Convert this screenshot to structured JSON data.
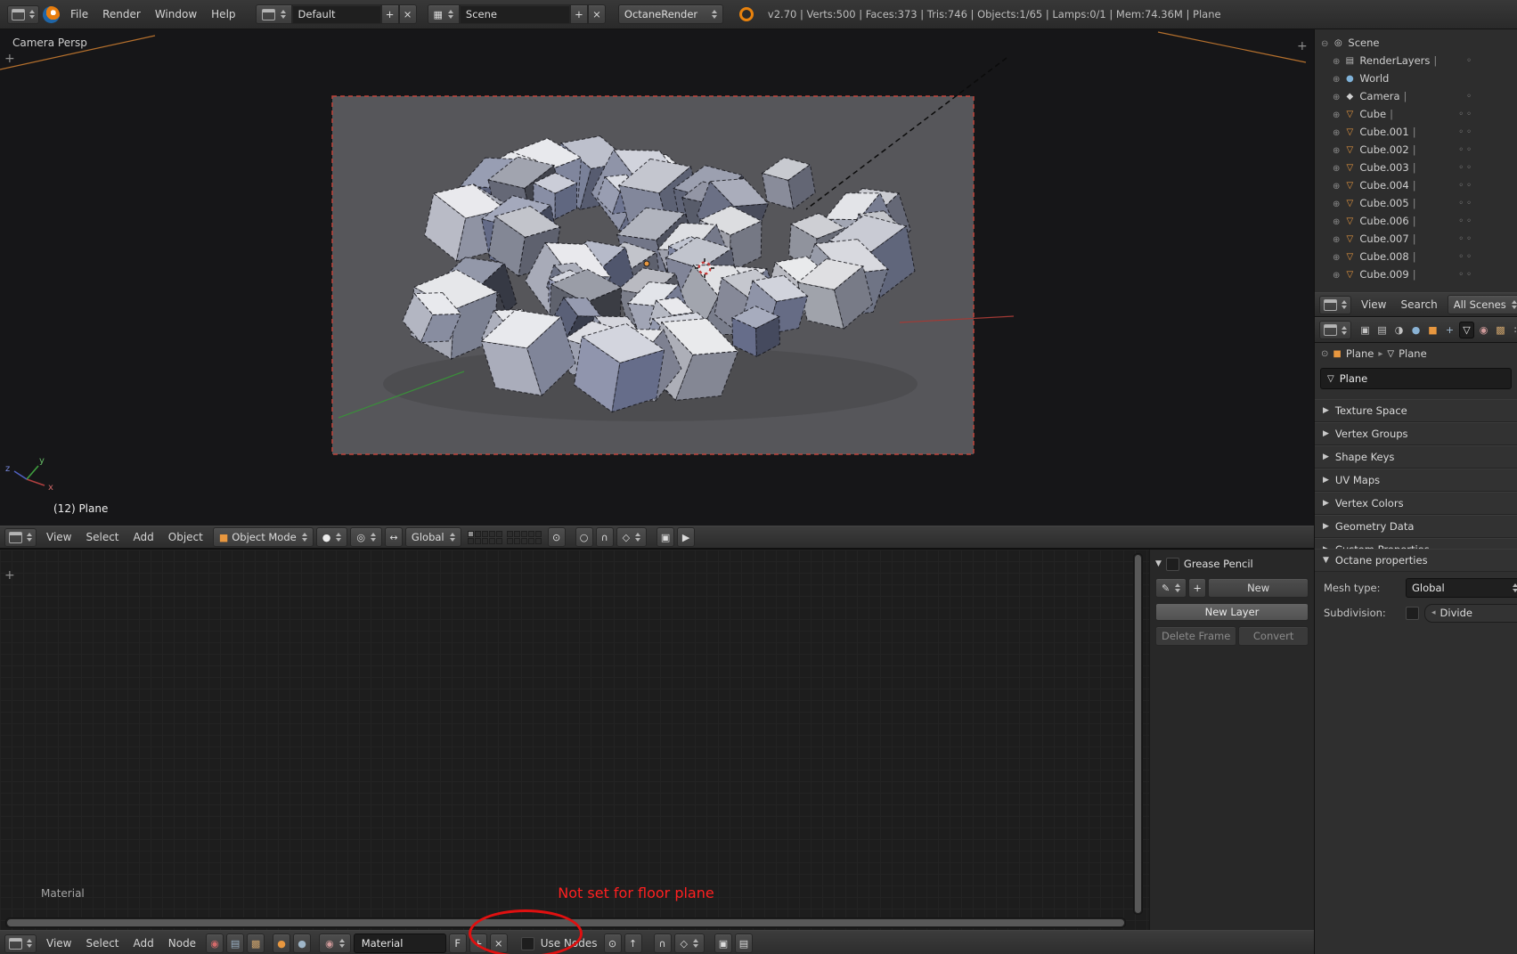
{
  "top_header": {
    "menus": [
      "File",
      "Render",
      "Window",
      "Help"
    ],
    "layout": {
      "value": "Default",
      "add": "+",
      "close": "×"
    },
    "scene": {
      "value": "Scene",
      "add": "+",
      "close": "×"
    },
    "engine": {
      "value": "OctaneRender"
    },
    "stats": "v2.70 | Verts:500 | Faces:373 | Tris:746 | Objects:1/65 | Lamps:0/1 | Mem:74.36M | Plane"
  },
  "viewport": {
    "view_label": "Camera Persp",
    "object_info": "(12) Plane",
    "axis": {
      "x": "x",
      "y": "y",
      "z": "z"
    },
    "header": {
      "menus": [
        "View",
        "Select",
        "Add",
        "Object"
      ],
      "mode": "Object Mode",
      "orientation": "Global"
    }
  },
  "node_editor": {
    "region_label": "Material",
    "annotation": "Not set for floor plane",
    "header": {
      "menus": [
        "View",
        "Select",
        "Add",
        "Node"
      ],
      "material_name": "Material",
      "fake_user": "F",
      "add": "+",
      "unlink": "×",
      "use_nodes_label": "Use Nodes"
    },
    "grease_pencil": {
      "title": "Grease Pencil",
      "add": "+",
      "new": "New",
      "new_layer": "New Layer",
      "delete_frame": "Delete Frame",
      "convert": "Convert"
    }
  },
  "outliner": {
    "items": [
      {
        "label": "Scene",
        "type": "scene",
        "indent": 0,
        "suffix": "",
        "expanded": true
      },
      {
        "label": "RenderLayers",
        "type": "renderlayers",
        "indent": 1,
        "suffix": "|"
      },
      {
        "label": "World",
        "type": "world",
        "indent": 1,
        "suffix": ""
      },
      {
        "label": "Camera",
        "type": "camera",
        "indent": 1,
        "suffix": "|"
      },
      {
        "label": "Cube",
        "type": "mesh",
        "indent": 1,
        "suffix": "|"
      },
      {
        "label": "Cube.001",
        "type": "mesh",
        "indent": 1,
        "suffix": "|"
      },
      {
        "label": "Cube.002",
        "type": "mesh",
        "indent": 1,
        "suffix": "|"
      },
      {
        "label": "Cube.003",
        "type": "mesh",
        "indent": 1,
        "suffix": "|"
      },
      {
        "label": "Cube.004",
        "type": "mesh",
        "indent": 1,
        "suffix": "|"
      },
      {
        "label": "Cube.005",
        "type": "mesh",
        "indent": 1,
        "suffix": "|"
      },
      {
        "label": "Cube.006",
        "type": "mesh",
        "indent": 1,
        "suffix": "|"
      },
      {
        "label": "Cube.007",
        "type": "mesh",
        "indent": 1,
        "suffix": "|"
      },
      {
        "label": "Cube.008",
        "type": "mesh",
        "indent": 1,
        "suffix": "|"
      },
      {
        "label": "Cube.009",
        "type": "mesh",
        "indent": 1,
        "suffix": "|"
      }
    ],
    "footer": {
      "menus": [
        "View",
        "Search"
      ],
      "scenes_filter": "All Scenes"
    }
  },
  "properties": {
    "tabs": [
      {
        "name": "render",
        "glyph": "▣",
        "color": "#c2c2c2"
      },
      {
        "name": "render-layers",
        "glyph": "▤",
        "color": "#c2c2c2"
      },
      {
        "name": "scene",
        "glyph": "◑",
        "color": "#c2c2c2"
      },
      {
        "name": "world",
        "glyph": "●",
        "color": "#89b2d4"
      },
      {
        "name": "object",
        "glyph": "■",
        "color": "#e8973f"
      },
      {
        "name": "modifiers",
        "glyph": "+",
        "color": "#9fb8cf"
      },
      {
        "name": "object-data",
        "glyph": "▽",
        "color": "#efefef",
        "active": true
      },
      {
        "name": "material",
        "glyph": "◉",
        "color": "#d09a9a"
      },
      {
        "name": "texture",
        "glyph": "▩",
        "color": "#c9a06a"
      },
      {
        "name": "particles",
        "glyph": "∷",
        "color": "#c2c2c2"
      },
      {
        "name": "physics",
        "glyph": "↻",
        "color": "#8fc6e8"
      }
    ],
    "breadcrumb": {
      "object": "Plane",
      "data": "Plane"
    },
    "name_field": "Plane",
    "panels": [
      "Texture Space",
      "Vertex Groups",
      "Shape Keys",
      "UV Maps",
      "Vertex Colors",
      "Geometry Data",
      "Custom Properties"
    ],
    "octane_panel": {
      "title": "Octane properties",
      "mesh_type_label": "Mesh type:",
      "mesh_type_value": "Global",
      "subdivision_label": "Subdivision:",
      "divide_label": "Divide"
    }
  }
}
